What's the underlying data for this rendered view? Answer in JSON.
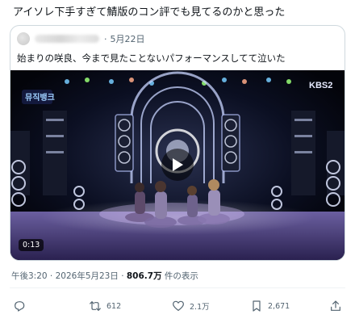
{
  "tweet": {
    "text": "アイソレ下手すぎて鯖版のコン評でも見てるのかと思った"
  },
  "quote": {
    "date": "5月22日",
    "separator": "·",
    "text": "始まりの咲良、今まで見たことないパフォーマンスしてて泣いた",
    "video": {
      "duration": "0:13",
      "broadcaster_logo": "KBS2",
      "show_logo": "뮤직뱅크"
    }
  },
  "meta": {
    "time_date": "午後3:20 · 2026年5月23日 · ",
    "views_count": "806.7万",
    "views_label": " 件の表示"
  },
  "actions": {
    "reposts": "612",
    "likes": "2.1万",
    "bookmarks": "2,671"
  },
  "icons": {
    "reply": "reply-icon",
    "repost": "repost-icon",
    "like": "heart-icon",
    "bookmark": "bookmark-icon",
    "share": "share-icon",
    "play": "play-icon"
  },
  "colors": {
    "text": "#0f1419",
    "secondary": "#536471",
    "border": "#cfd9de"
  }
}
